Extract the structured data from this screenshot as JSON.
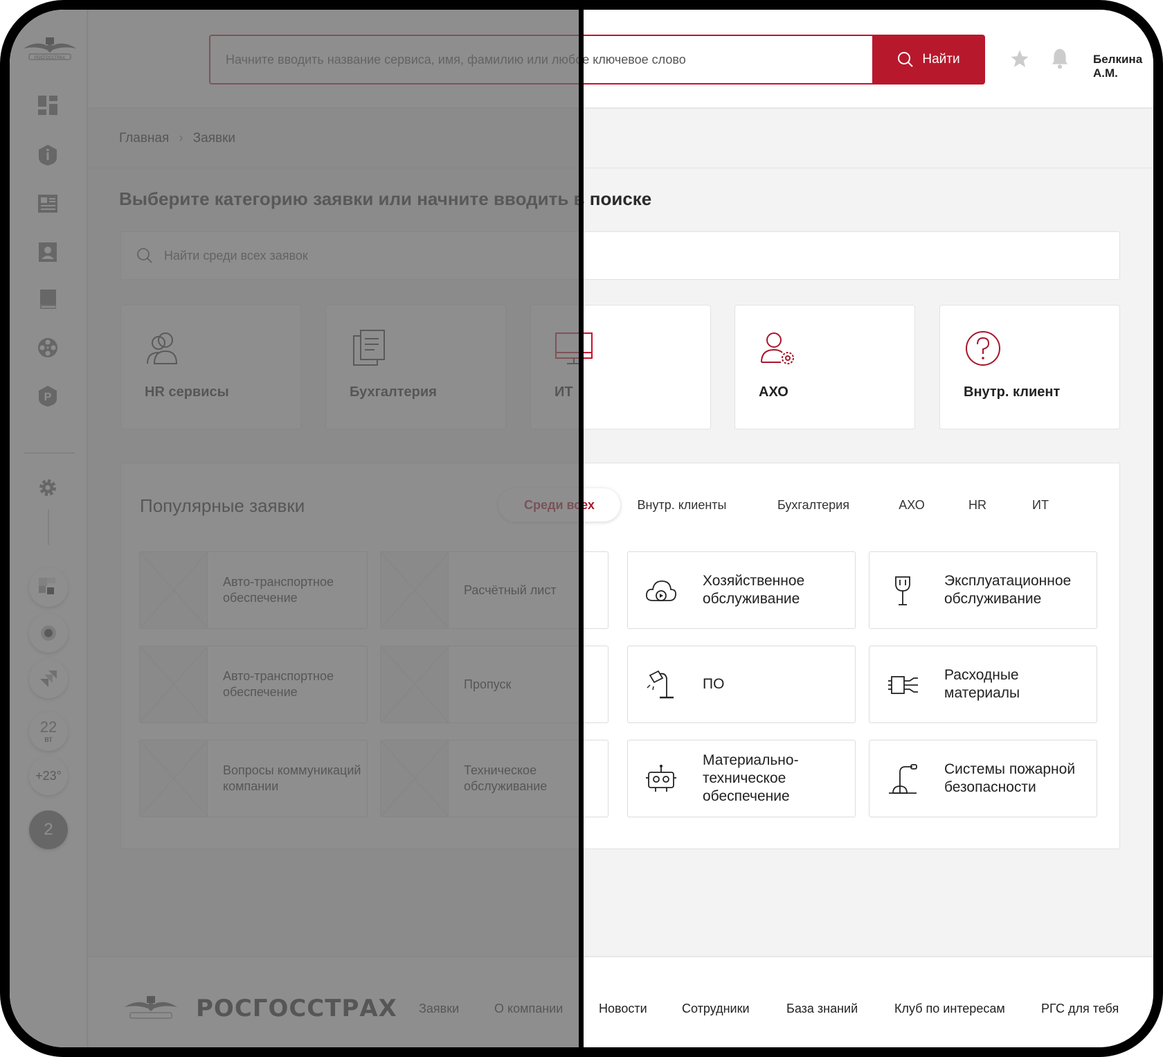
{
  "header": {
    "search_placeholder": "Начните вводить название сервиса, имя, фамилию или любое ключевое слово",
    "search_button": "Найти",
    "user_name": "Белкина А.М."
  },
  "sidebar": {
    "icons": [
      "dashboard-icon",
      "info-shield-icon",
      "news-icon",
      "contacts-icon",
      "book-icon",
      "film-reel-icon",
      "parking-icon",
      "gear-icon"
    ],
    "apps": [
      {
        "name": "app-tile-1"
      },
      {
        "name": "app-search"
      },
      {
        "name": "app-jira"
      }
    ],
    "calendar": {
      "day": "22",
      "weekday": "вт"
    },
    "weather": "+23°",
    "notifications": "2"
  },
  "breadcrumb": [
    "Главная",
    "Заявки"
  ],
  "page_title": "Выберите категорию заявки или начните вводить в поиске",
  "request_search_placeholder": "Найти среди всех заявок",
  "categories": [
    {
      "label": "HR сервисы",
      "icon": "people-icon"
    },
    {
      "label": "Бухгалтерия",
      "icon": "documents-icon"
    },
    {
      "label": "ИТ",
      "icon": "monitor-icon"
    },
    {
      "label": "АХО",
      "icon": "person-gear-icon"
    },
    {
      "label": "Внутр. клиент",
      "icon": "question-circle-icon"
    }
  ],
  "popular": {
    "title": "Популярные заявки",
    "tabs": [
      "Среди всех",
      "Внутр. клиенты",
      "Бухгалтерия",
      "АХО",
      "HR",
      "ИТ"
    ],
    "items": [
      {
        "label": "Авто-транспортное обеспечение"
      },
      {
        "label": "Расчётный лист"
      },
      {
        "label": "Хозяйственное обслуживание",
        "icon": "cloud-play-icon"
      },
      {
        "label": "Эксплуатационное обслуживание",
        "icon": "microphone-stand-icon"
      },
      {
        "label": "Авто-транспортное обеспечение"
      },
      {
        "label": "Пропуск"
      },
      {
        "label": "ПО",
        "icon": "desk-lamp-icon"
      },
      {
        "label": "Расходные материалы",
        "icon": "chip-icon"
      },
      {
        "label": "Вопросы коммуникаций компании"
      },
      {
        "label": "Техническое обслуживание"
      },
      {
        "label": "Материально-техническое обеспечение",
        "icon": "robot-icon"
      },
      {
        "label": "Системы пожарной безопасности",
        "icon": "lamp-post-icon"
      }
    ]
  },
  "footer": {
    "brand": "РОСГОССТРАХ",
    "links": [
      "Заявки",
      "О компании",
      "Новости",
      "Сотрудники",
      "База знаний",
      "Клуб по интересам",
      "РГС для тебя"
    ]
  },
  "colors": {
    "accent": "#b8182c",
    "overlay": "#686868"
  }
}
